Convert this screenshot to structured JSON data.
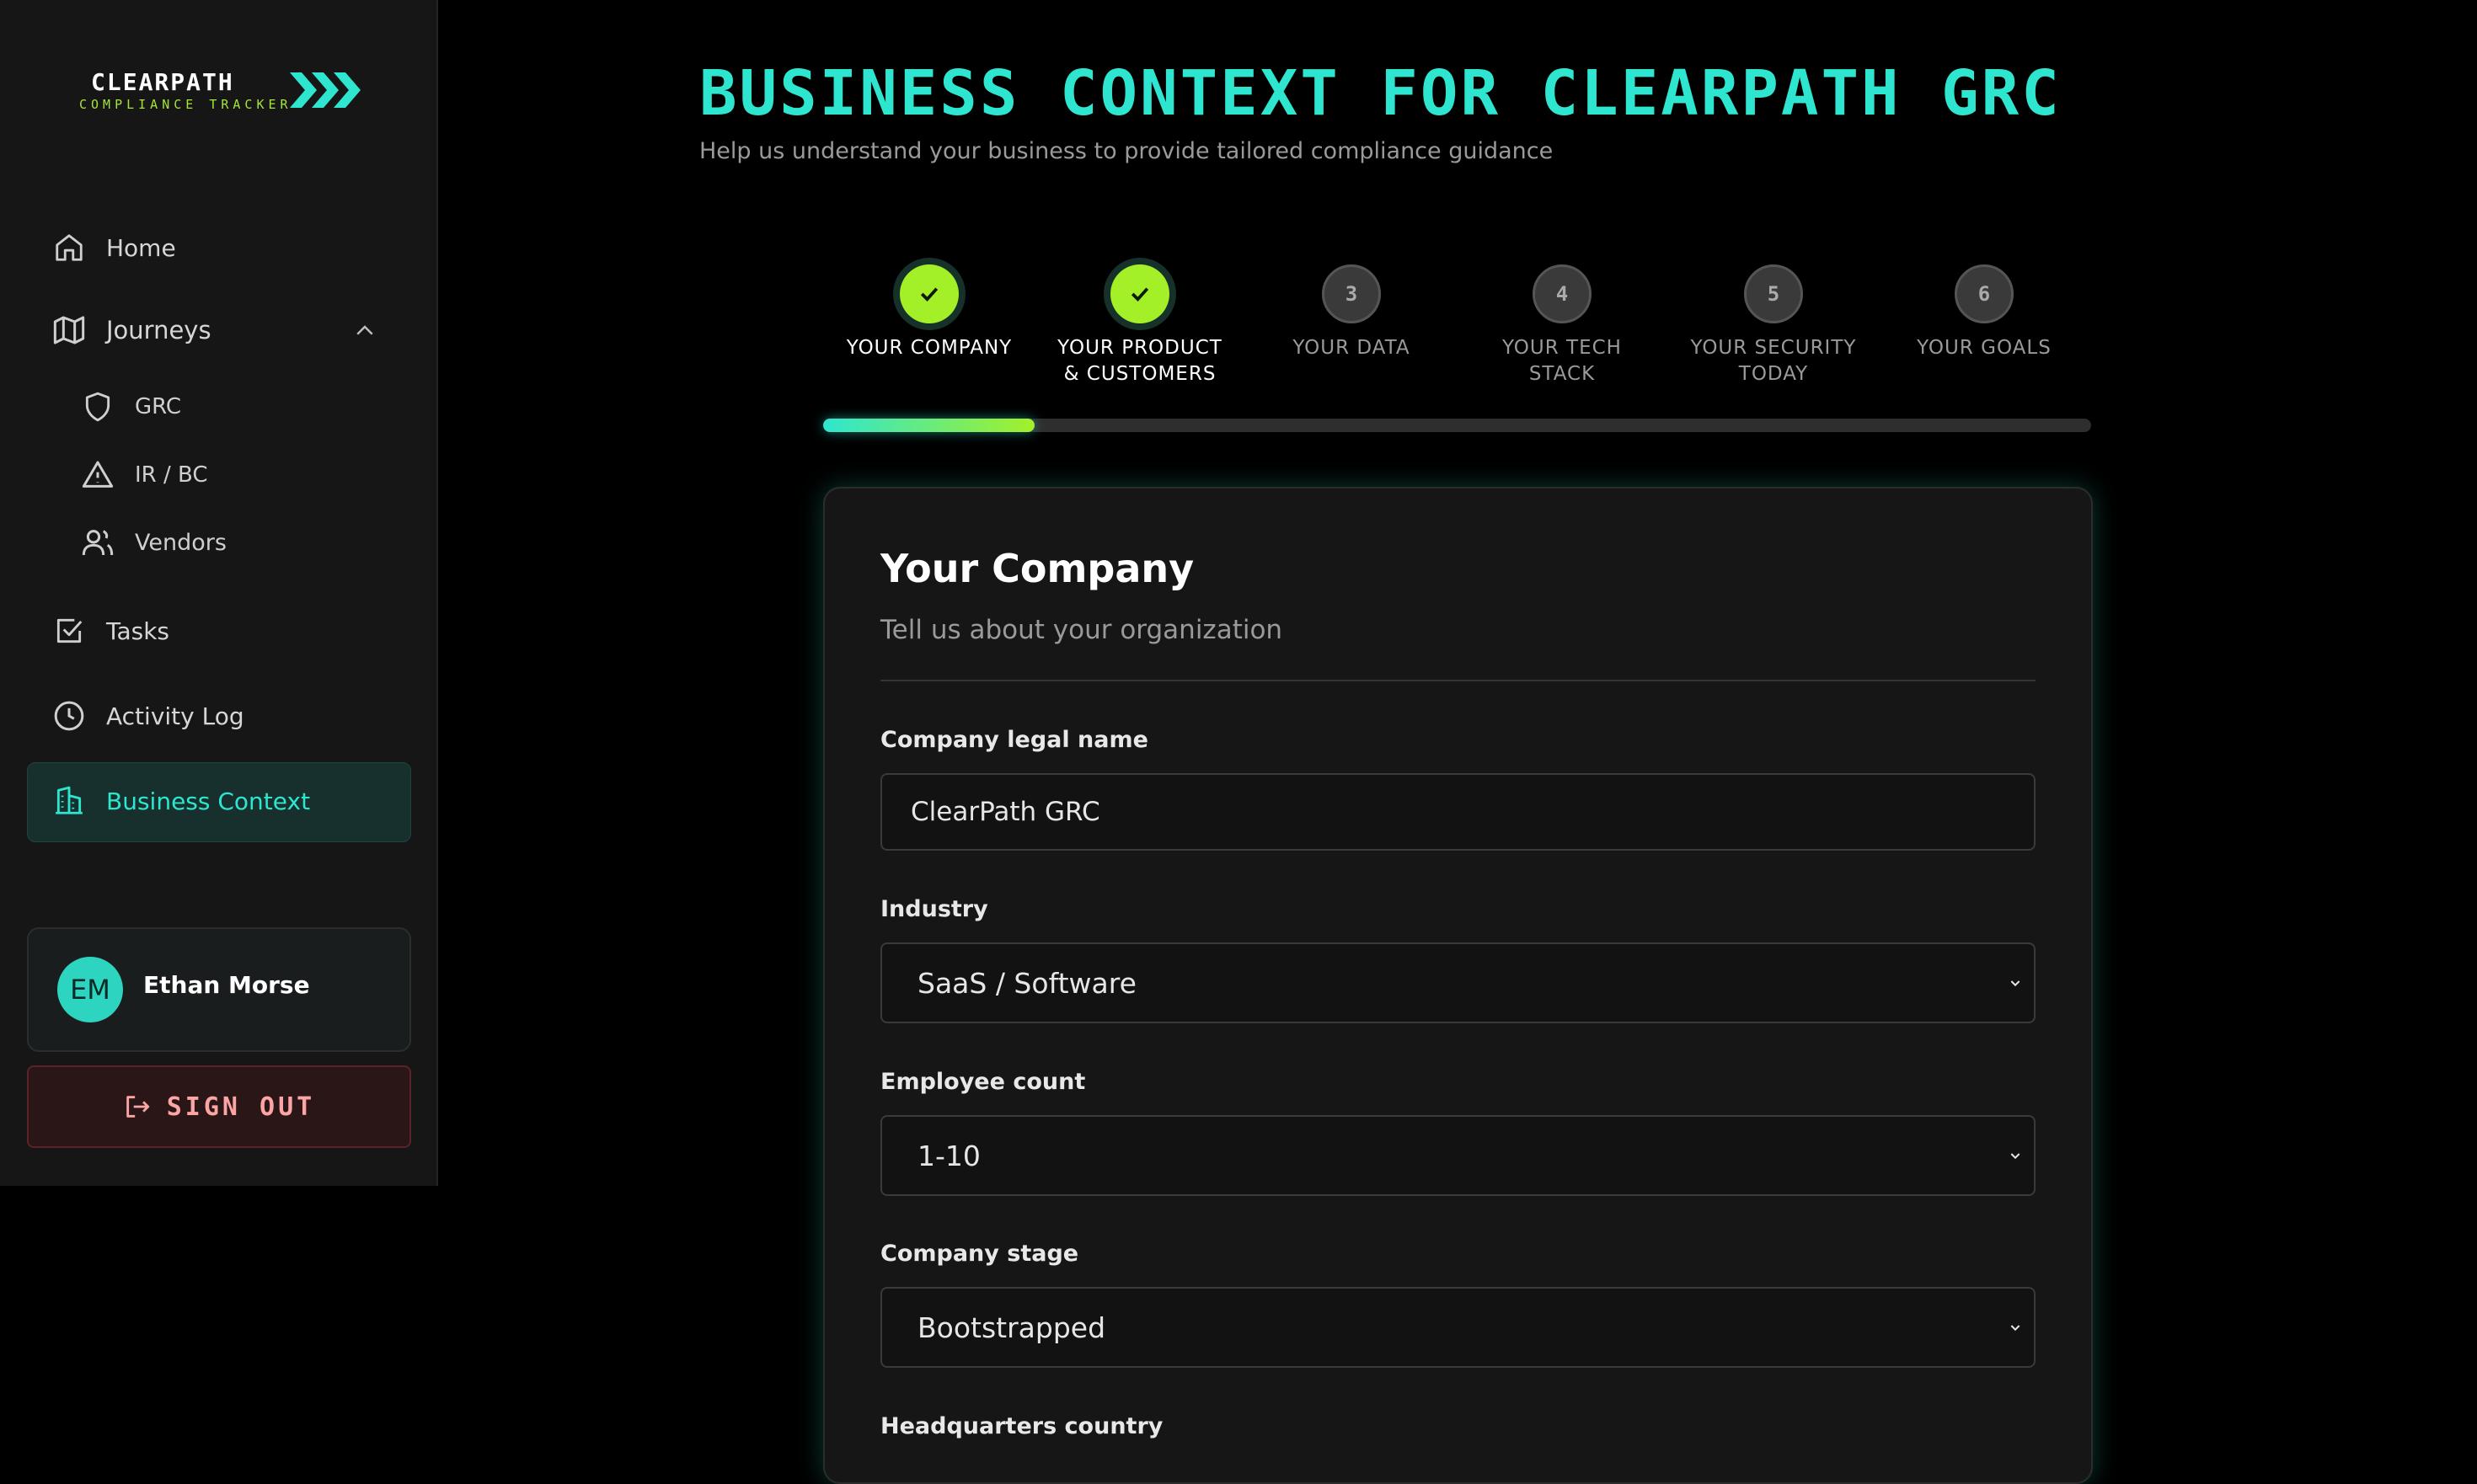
{
  "app": {
    "logo_title": "CLEARPATH",
    "logo_subtitle": "COMPLIANCE TRACKER"
  },
  "colors": {
    "accent": "#2ee6d0",
    "lime": "#a3f028",
    "danger": "#fca5a5"
  },
  "sidebar": {
    "items": [
      {
        "label": "Home",
        "icon": "home-icon"
      },
      {
        "label": "Journeys",
        "icon": "map-icon"
      },
      {
        "label": "GRC",
        "icon": "shield-icon"
      },
      {
        "label": "IR / BC",
        "icon": "warning-icon"
      },
      {
        "label": "Vendors",
        "icon": "users-icon"
      },
      {
        "label": "Tasks",
        "icon": "checkbox-icon"
      },
      {
        "label": "Activity Log",
        "icon": "clock-icon"
      },
      {
        "label": "Business Context",
        "icon": "building-icon"
      }
    ],
    "user": {
      "initials": "EM",
      "name": "Ethan Morse"
    },
    "signout_label": "SIGN OUT"
  },
  "main": {
    "title": "BUSINESS CONTEXT FOR CLEARPATH GRC",
    "subtitle": "Help us understand your business to provide tailored compliance guidance",
    "steps": [
      {
        "number": "1",
        "label_line1": "YOUR COMPANY",
        "label_line2": "",
        "status": "done"
      },
      {
        "number": "2",
        "label_line1": "YOUR PRODUCT",
        "label_line2": "& CUSTOMERS",
        "status": "done"
      },
      {
        "number": "3",
        "label_line1": "YOUR DATA",
        "label_line2": "",
        "status": "todo"
      },
      {
        "number": "4",
        "label_line1": "YOUR TECH",
        "label_line2": "STACK",
        "status": "todo"
      },
      {
        "number": "5",
        "label_line1": "YOUR SECURITY",
        "label_line2": "TODAY",
        "status": "todo"
      },
      {
        "number": "6",
        "label_line1": "YOUR GOALS",
        "label_line2": "",
        "status": "todo"
      }
    ],
    "progress_fraction": 0.167,
    "card": {
      "title": "Your Company",
      "subtitle": "Tell us about your organization",
      "fields": {
        "legal_name": {
          "label": "Company legal name",
          "value": "ClearPath GRC"
        },
        "industry": {
          "label": "Industry",
          "value": "SaaS / Software"
        },
        "employee_count": {
          "label": "Employee count",
          "value": "1-10"
        },
        "stage": {
          "label": "Company stage",
          "value": "Bootstrapped"
        },
        "hq_country": {
          "label": "Headquarters country"
        }
      }
    }
  }
}
